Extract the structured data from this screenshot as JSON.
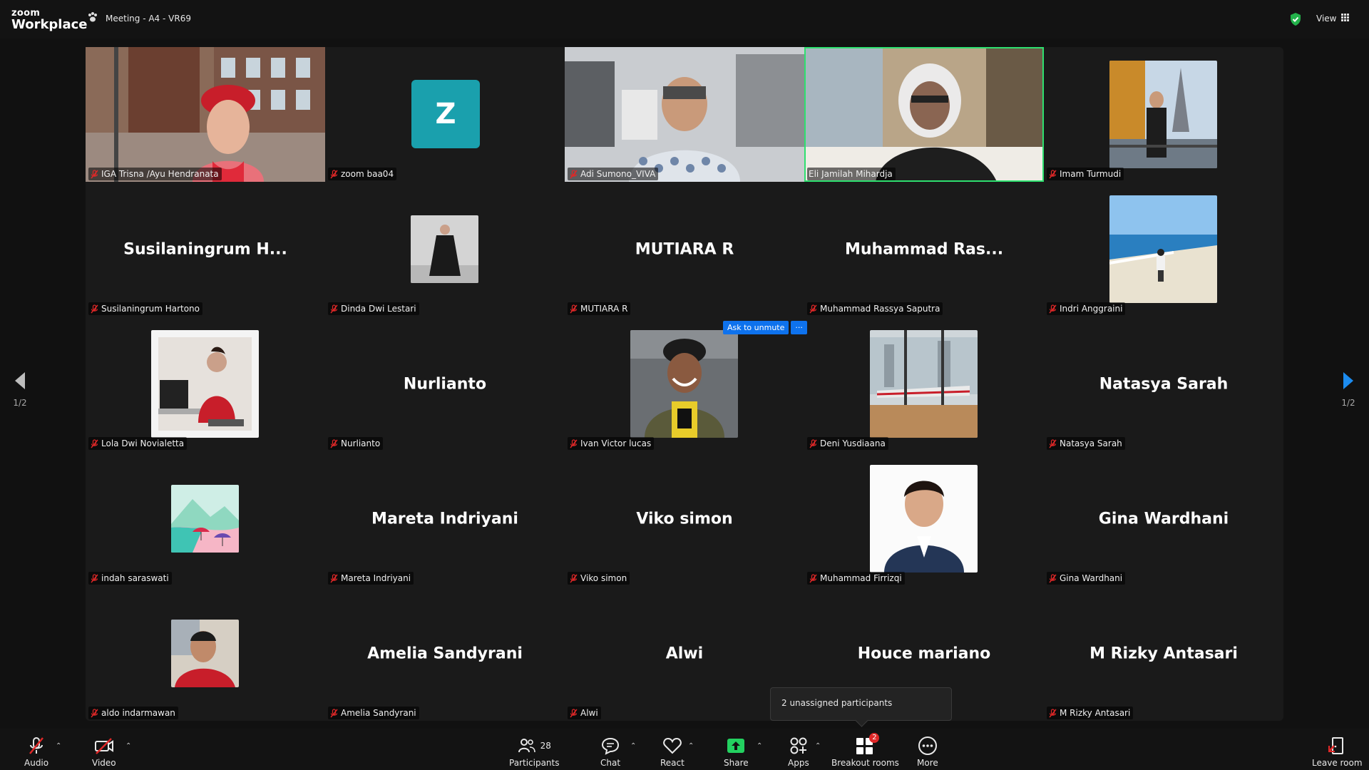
{
  "app": {
    "logo_line1": "zoom",
    "logo_line2": "Workplace",
    "meeting_title": "Meeting - A4 - VR69",
    "view_label": "View"
  },
  "tiles": [
    {
      "name": "IGA Trisna /Ayu Hendranata",
      "type": "video",
      "scene": "street",
      "speaking": false
    },
    {
      "name": "zoom baa04",
      "type": "avatar",
      "initial": "Z"
    },
    {
      "name": "Adi Sumono_VIVA",
      "type": "video",
      "scene": "office",
      "speaking": false
    },
    {
      "name": "Eli Jamilah Mihardja",
      "type": "video",
      "scene": "room",
      "speaking": true
    },
    {
      "name": "Imam Turmudi",
      "type": "photo",
      "scene": "paris"
    },
    {
      "name": "Susilaningrum Hartono",
      "type": "text",
      "display": "Susilaningrum  H..."
    },
    {
      "name": "Dinda Dwi Lestari",
      "type": "photo-small",
      "scene": "fashion"
    },
    {
      "name": "MUTIARA R",
      "type": "text",
      "display": "MUTIARA R"
    },
    {
      "name": "Muhammad Rassya Saputra",
      "type": "text",
      "display": "Muhammad  Ras..."
    },
    {
      "name": "Indri Anggraini",
      "type": "photo",
      "scene": "beach"
    },
    {
      "name": "Lola Dwi Novialetta",
      "type": "photo",
      "scene": "desk"
    },
    {
      "name": "Nurlianto",
      "type": "text",
      "display": "Nurlianto"
    },
    {
      "name": "Ivan Victor lucas",
      "type": "photo",
      "scene": "beanie"
    },
    {
      "name": "Deni Yusdiaana",
      "type": "photo",
      "scene": "train"
    },
    {
      "name": "Natasya Sarah",
      "type": "text",
      "display": "Natasya Sarah"
    },
    {
      "name": "indah saraswati",
      "type": "photo-small",
      "scene": "cartoon"
    },
    {
      "name": "Mareta Indriyani",
      "type": "text",
      "display": "Mareta Indriyani"
    },
    {
      "name": "Viko simon",
      "type": "text",
      "display": "Viko simon"
    },
    {
      "name": "Muhammad Firrizqi",
      "type": "photo",
      "scene": "portrait"
    },
    {
      "name": "Gina Wardhani",
      "type": "text",
      "display": "Gina Wardhani"
    },
    {
      "name": "aldo indarmawan",
      "type": "photo-small",
      "scene": "selfie"
    },
    {
      "name": "Amelia Sandyrani",
      "type": "text",
      "display": "Amelia Sandyrani"
    },
    {
      "name": "Alwi",
      "type": "text",
      "display": "Alwi"
    },
    {
      "name": "Houce mariano",
      "type": "text",
      "display": "Houce mariano",
      "nolabel": true
    },
    {
      "name": "M Rizky Antasari",
      "type": "text",
      "display": "M Rizky Antasari"
    }
  ],
  "ask_unmute": {
    "label": "Ask to unmute",
    "more": "···"
  },
  "paging": {
    "left": "1/2",
    "right": "1/2"
  },
  "popup": {
    "text": "2 unassigned participants"
  },
  "toolbar": {
    "audio": "Audio",
    "video": "Video",
    "participants": "Participants",
    "participants_count": "28",
    "chat": "Chat",
    "react": "React",
    "share": "Share",
    "apps": "Apps",
    "breakout": "Breakout rooms",
    "breakout_badge": "2",
    "more": "More",
    "leave": "Leave room"
  },
  "colors": {
    "speaking": "#2ee06f",
    "accent": "#0e72ed",
    "share": "#23d160",
    "mute": "#e02828"
  }
}
